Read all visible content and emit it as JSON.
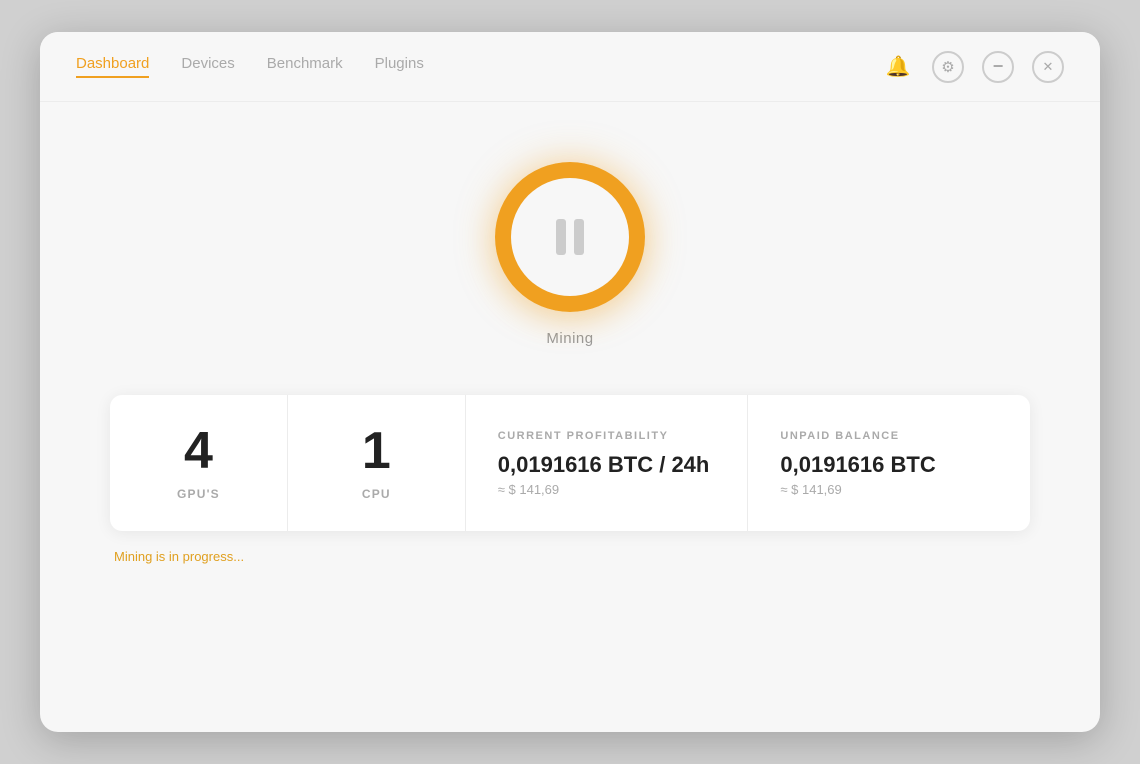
{
  "nav": {
    "links": [
      {
        "id": "dashboard",
        "label": "Dashboard",
        "active": true
      },
      {
        "id": "devices",
        "label": "Devices",
        "active": false
      },
      {
        "id": "benchmark",
        "label": "Benchmark",
        "active": false
      },
      {
        "id": "plugins",
        "label": "Plugins",
        "active": false
      }
    ],
    "icons": [
      {
        "id": "bell",
        "symbol": "🔔",
        "label": "Notifications"
      },
      {
        "id": "gear",
        "symbol": "⚙",
        "label": "Settings"
      },
      {
        "id": "minus",
        "symbol": "−",
        "label": "Minimize"
      },
      {
        "id": "close",
        "symbol": "✕",
        "label": "Close"
      }
    ]
  },
  "mining": {
    "button_label": "Mining",
    "state": "paused"
  },
  "stats": [
    {
      "id": "gpus",
      "value": "4",
      "label": "GPU'S",
      "type": "simple"
    },
    {
      "id": "cpu",
      "value": "1",
      "label": "CPU",
      "type": "simple"
    },
    {
      "id": "profitability",
      "section_label": "CURRENT PROFITABILITY",
      "main_value": "0,0191616 BTC / 24h",
      "sub_value": "≈ $ 141,69",
      "type": "wide"
    },
    {
      "id": "balance",
      "section_label": "UNPAID BALANCE",
      "main_value": "0,0191616 BTC",
      "sub_value": "≈ $ 141,69",
      "type": "wide"
    }
  ],
  "bottom_hint": "Mining is in progress..."
}
